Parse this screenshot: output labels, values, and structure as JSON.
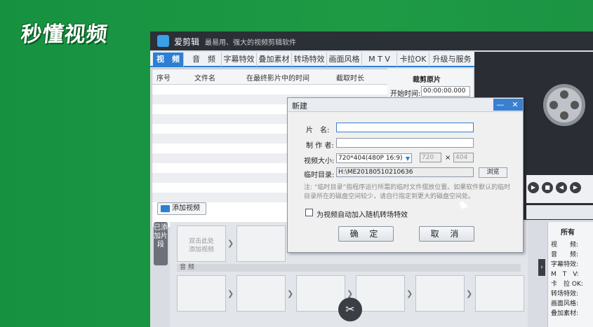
{
  "watermark": {
    "text": "秒懂视频"
  },
  "app": {
    "name": "爱剪辑",
    "tagline": "最易用、强大的视频剪辑软件"
  },
  "tabs": [
    {
      "label": "视　频",
      "active": true
    },
    {
      "label": "音　频"
    },
    {
      "label": "字幕特效"
    },
    {
      "label": "叠加素材"
    },
    {
      "label": "转场特效"
    },
    {
      "label": "画面风格"
    },
    {
      "label": "M T V"
    },
    {
      "label": "卡拉OK"
    },
    {
      "label": "升级与服务"
    }
  ],
  "table": {
    "headers": [
      "序号",
      "文件名",
      "在最终影片中的时间",
      "截取时长"
    ]
  },
  "crop": {
    "title": "裁剪原片",
    "start_label": "开始时间:",
    "start_value": "00:00:00.000"
  },
  "add_video_button": "添加视频",
  "added_clips_tab": "已添加片段",
  "timeline": {
    "first_clip_text_1": "双击此处",
    "first_clip_text_2": "添加视频",
    "audio_label": "音 频"
  },
  "info_panel": {
    "title": "所有",
    "rows": [
      "视　　频:",
      "音　　频:",
      "字幕特效:",
      "M　T　V:",
      "卡　拉 OK:",
      "转场特效:",
      "画面风格:",
      "叠加素材:"
    ]
  },
  "dialog": {
    "title": "新建",
    "fields": {
      "title_label": "片　名:",
      "title_value": "",
      "author_label": "制 作 者:",
      "author_value": "",
      "size_label": "视频大小:",
      "size_value": "720*404(480P 16:9)",
      "width_value": "720",
      "x_sign": "×",
      "height_value": "404",
      "tempdir_label": "临时目录:",
      "tempdir_value": "H:\\ME20180510210636",
      "browse_label": "浏览"
    },
    "note": "注: “临时目录”指程序运行所需的临时文件摆放位置。如果软件默认的临时目录所在的磁盘空间较少，请自行指定到更大的磁盘空间处。",
    "checkbox_label": "为视频自动加入随机转场特效",
    "checkbox_checked": false,
    "ok_label": "确 定",
    "cancel_label": "取 消"
  },
  "colors": {
    "accent": "#2d7fd3",
    "background": "#1a8f3c",
    "titlebar": "#2b2f36"
  }
}
